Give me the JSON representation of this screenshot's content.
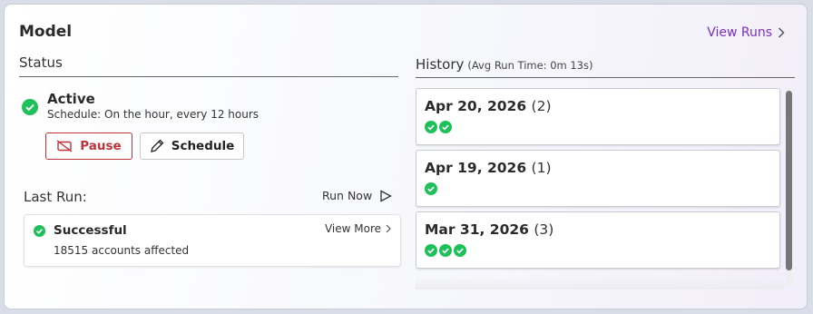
{
  "header": {
    "title": "Model",
    "view_runs_label": "View Runs"
  },
  "status": {
    "heading": "Status",
    "state": "Active",
    "schedule": "Schedule: On the hour, every 12 hours",
    "pause_label": "Pause",
    "schedule_label": "Schedule",
    "state_color": "#1fbf5b"
  },
  "last_run": {
    "heading": "Last Run:",
    "run_now_label": "Run Now",
    "result": "Successful",
    "affected": "18515 accounts affected",
    "view_more_label": "View More"
  },
  "history": {
    "heading": "History",
    "avg_run_time": "(Avg Run Time: 0m 13s)",
    "items": [
      {
        "date": "Apr 20, 2026",
        "count": "(2)",
        "successes": 2
      },
      {
        "date": "Apr 19, 2026",
        "count": "(1)",
        "successes": 1
      },
      {
        "date": "Mar 31, 2026",
        "count": "(3)",
        "successes": 3
      }
    ]
  },
  "colors": {
    "accent": "#7a2fc4",
    "danger": "#c0313a",
    "success": "#1fbf5b"
  },
  "icons": [
    "check-circle-icon",
    "chevron-right-icon",
    "pause-off-icon",
    "pencil-icon",
    "play-icon"
  ]
}
